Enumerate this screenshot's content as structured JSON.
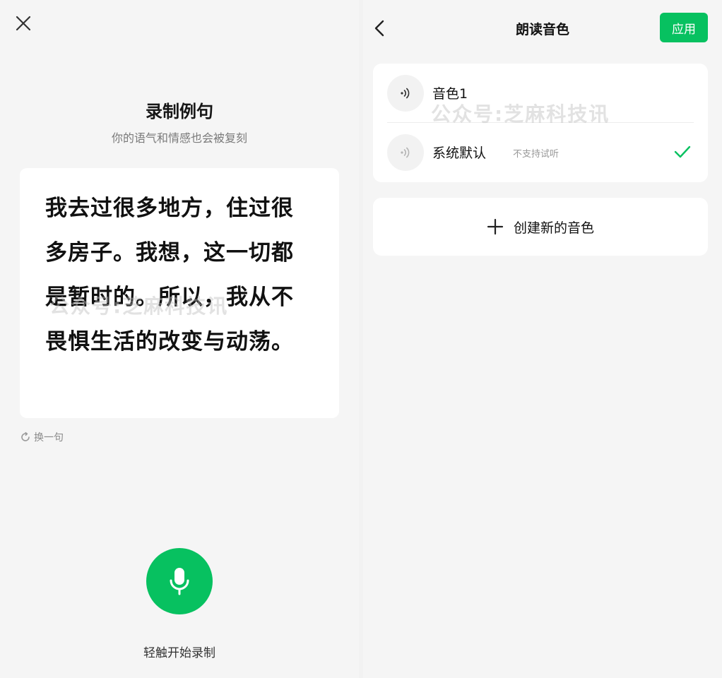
{
  "left_panel": {
    "title": "录制例句",
    "subtitle": "你的语气和情感也会被复刻",
    "sentence": "我去过很多地方，住过很多房子。我想，这一切都是暂时的。所以，我从不畏惧生活的改变与动荡。",
    "switch_label": "换一句",
    "record_hint": "轻触开始录制",
    "watermark": "公众号:芝麻科技讯",
    "icons": {
      "close": "close-icon",
      "refresh": "refresh-icon",
      "mic": "microphone-icon"
    }
  },
  "right_panel": {
    "title": "朗读音色",
    "apply_label": "应用",
    "voices": [
      {
        "name": "音色1",
        "note": "",
        "selected": false
      },
      {
        "name": "系统默认",
        "note": "不支持试听",
        "selected": true
      }
    ],
    "create_label": "创建新的音色",
    "watermark": "公众号:芝麻科技讯",
    "icons": {
      "back": "back-icon",
      "play": "sound-wave-icon",
      "check": "check-icon",
      "plus": "plus-icon"
    }
  },
  "colors": {
    "accent_green": "#07c160",
    "background": "#f5f5f5",
    "card": "#ffffff",
    "secondary_text": "#7a7a7a"
  }
}
